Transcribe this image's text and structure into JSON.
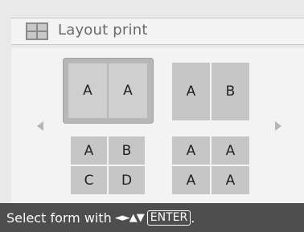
{
  "header": {
    "title": "Layout print",
    "icon": "layout-grid-icon"
  },
  "nav": {
    "left_icon": "triangle-left-icon",
    "right_icon": "triangle-right-icon"
  },
  "options": [
    {
      "cells": [
        "A",
        "A"
      ],
      "selected": true
    },
    {
      "cells": [
        "A",
        "B"
      ],
      "selected": false
    },
    {
      "cells": [
        "A",
        "B",
        "C",
        "D"
      ],
      "selected": false
    },
    {
      "cells": [
        "A",
        "A",
        "A",
        "A"
      ],
      "selected": false
    }
  ],
  "footer": {
    "instruction": "Select form with",
    "keys": "◄►▲▼",
    "enter": "ENTER",
    "end": "."
  }
}
